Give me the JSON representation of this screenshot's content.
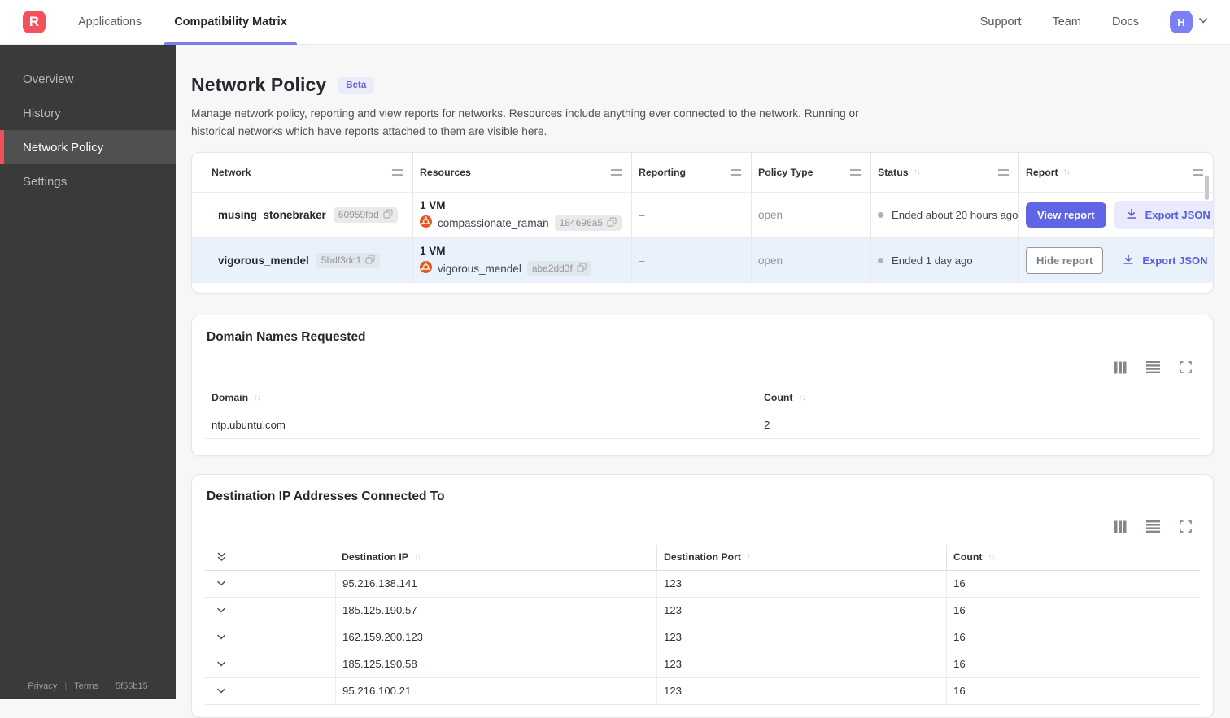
{
  "navbar": {
    "logo_letter": "R",
    "tabs": [
      {
        "label": "Applications"
      },
      {
        "label": "Compatibility Matrix"
      }
    ],
    "links": [
      "Support",
      "Team",
      "Docs"
    ],
    "avatar_letter": "H"
  },
  "sidebar": {
    "items": [
      {
        "label": "Overview"
      },
      {
        "label": "History"
      },
      {
        "label": "Network Policy"
      },
      {
        "label": "Settings"
      }
    ],
    "footer": {
      "privacy": "Privacy",
      "terms": "Terms",
      "build": "5f56b15"
    }
  },
  "page": {
    "title": "Network Policy",
    "beta_badge": "Beta",
    "description": "Manage network policy, reporting and view reports for networks. Resources include anything ever connected to the network. Running or historical networks which have reports attached to them are visible here."
  },
  "networks_table": {
    "columns": [
      "Network",
      "Resources",
      "Reporting",
      "Policy Type",
      "Status",
      "Report"
    ],
    "rows": [
      {
        "name": "musing_stonebraker",
        "id": "60959fad",
        "vm_count": "1 VM",
        "resource_name": "compassionate_raman",
        "resource_id": "184696a5",
        "reporting": "–",
        "policy_type": "open",
        "status": "Ended about 20 hours ago",
        "report_button": "View report",
        "export_button": "Export JSON"
      },
      {
        "name": "vigorous_mendel",
        "id": "5bdf3dc1",
        "vm_count": "1 VM",
        "resource_name": "vigorous_mendel",
        "resource_id": "aba2dd3f",
        "reporting": "–",
        "policy_type": "open",
        "status": "Ended 1 day ago",
        "report_button": "Hide report",
        "export_button": "Export JSON"
      }
    ]
  },
  "domains_card": {
    "title": "Domain Names Requested",
    "columns": [
      "Domain",
      "Count"
    ],
    "rows": [
      {
        "domain": "ntp.ubuntu.com",
        "count": "2"
      }
    ]
  },
  "ips_card": {
    "title": "Destination IP Addresses Connected To",
    "columns": [
      "Destination IP",
      "Destination Port",
      "Count"
    ],
    "rows": [
      {
        "ip": "95.216.138.141",
        "port": "123",
        "count": "16"
      },
      {
        "ip": "185.125.190.57",
        "port": "123",
        "count": "16"
      },
      {
        "ip": "162.159.200.123",
        "port": "123",
        "count": "16"
      },
      {
        "ip": "185.125.190.58",
        "port": "123",
        "count": "16"
      },
      {
        "ip": "95.216.100.21",
        "port": "123",
        "count": "16"
      }
    ]
  },
  "colors": {
    "brand_red": "#f4515c",
    "accent_indigo": "#6065e5",
    "tab_underline": "#7a7ef0",
    "avatar_bg": "#7b80f2",
    "sidebar_bg": "#3a3a3a",
    "sidebar_active_bg": "#505050",
    "sidebar_accent": "#ee5159",
    "row_highlight": "#e9f1fb",
    "beta_bg": "#ebebfa",
    "beta_text": "#6063d6",
    "ubuntu_orange": "#e95420"
  }
}
